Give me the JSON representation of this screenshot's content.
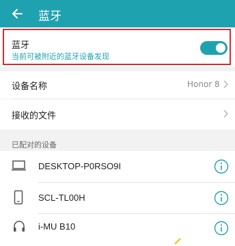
{
  "appbar": {
    "title": "蓝牙",
    "back_icon": "arrow-left-icon",
    "color": "#1fa2b0"
  },
  "bluetooth": {
    "title": "蓝牙",
    "subtitle": "当前可被附近的蓝牙设备发现",
    "enabled": true,
    "highlight_color": "#d52b33"
  },
  "settings": {
    "device_name_label": "设备名称",
    "device_name_value": "Honor 8",
    "received_files_label": "接收的文件"
  },
  "paired": {
    "header": "已配对的设备",
    "devices": [
      {
        "name": "DESKTOP-P0RSO9I",
        "icon": "laptop-icon"
      },
      {
        "name": "SCL-TL00H",
        "icon": "phone-icon"
      },
      {
        "name": "i-MU B10",
        "icon": "headset-icon"
      }
    ]
  }
}
